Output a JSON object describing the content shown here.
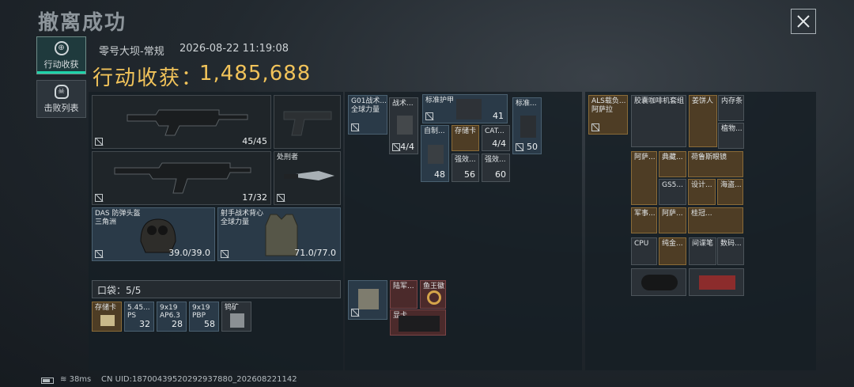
{
  "title": "撤离成功",
  "tabs": [
    {
      "label": "行动收获",
      "icon": "target-icon"
    },
    {
      "label": "击败列表",
      "icon": "skull-icon"
    }
  ],
  "map": "零号大坝-常规",
  "datetime": "2026-08-22 11:19:08",
  "haul": {
    "label": "行动收获：",
    "value": "1,485,688"
  },
  "equipment": {
    "primary_ammo": "45/45",
    "secondary_ammo": "17/32",
    "melee_label": "处刑者",
    "helmet_label": "DAS 防弹头盔\n三角洲",
    "helmet_durability": "39.0/39.0",
    "vest_label": "射手战术背心\n全球力量",
    "vest_durability": "71.0/77.0"
  },
  "pocket": {
    "label": "口袋：",
    "used": "5",
    "total": "/5"
  },
  "pocket_items": [
    {
      "label": "存储卡",
      "count": ""
    },
    {
      "label": "5.45...",
      "count": "32",
      "sub": "PS"
    },
    {
      "label": "9x19",
      "count": "28",
      "sub": "AP6.3"
    },
    {
      "label": "9x19",
      "count": "58",
      "sub": "PBP"
    },
    {
      "label": "钨矿",
      "count": ""
    }
  ],
  "rig_items": [
    {
      "label": "G01战术...\n全球力量",
      "count": ""
    },
    {
      "label": "战术...",
      "count": "4/4"
    },
    {
      "label": "标准护甲",
      "count": "41"
    },
    {
      "label": "标准...",
      "count": "50"
    },
    {
      "label": "自制...",
      "count": "48"
    },
    {
      "label": "存储卡",
      "count": "56"
    },
    {
      "label": "CAT...",
      "count": "4/4"
    },
    {
      "label": "强效...",
      "count": "60"
    }
  ],
  "bag_items": [
    {
      "label": "陆军...",
      "count": ""
    },
    {
      "label": "鱼王徽",
      "count": ""
    },
    {
      "label": "显卡",
      "count": ""
    }
  ],
  "backpack": {
    "label": "ALS载负...\n阿萨拉",
    "items": [
      {
        "label": "胶囊咖啡机套组"
      },
      {
        "label": "姜饼人"
      },
      {
        "label": "内存条"
      },
      {
        "label": "植物..."
      },
      {
        "label": "阿萨..."
      },
      {
        "label": "典藏..."
      },
      {
        "label": "荷鲁斯眼镜"
      },
      {
        "label": "GS5..."
      },
      {
        "label": "设计..."
      },
      {
        "label": "海盗..."
      },
      {
        "label": "军事..."
      },
      {
        "label": "阿萨..."
      },
      {
        "label": "桂冠..."
      },
      {
        "label": "CPU"
      },
      {
        "label": "纯金..."
      },
      {
        "label": "间谍笔"
      },
      {
        "label": "数码..."
      },
      {
        "label": ""
      },
      {
        "label": ""
      }
    ]
  },
  "status": {
    "ping": "38ms",
    "uid": "CN UID:18700439520292937880_202608221142"
  },
  "colors": {
    "accent": "#f1c35a",
    "tab_active": "#1ed2a8"
  }
}
